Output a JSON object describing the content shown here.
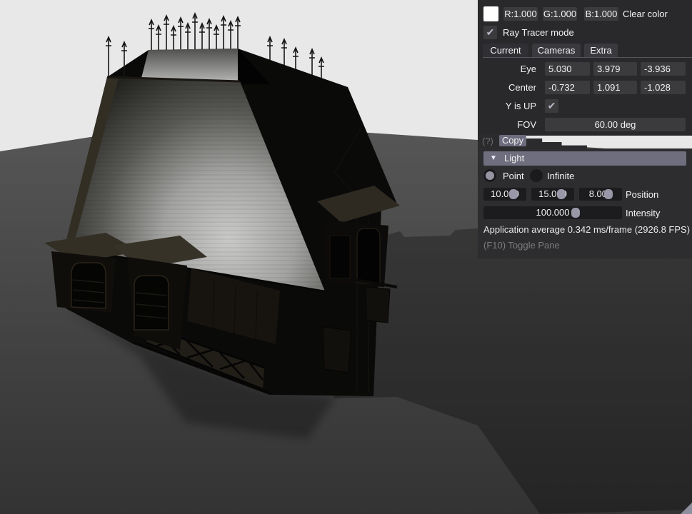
{
  "panel": {
    "clear_color": {
      "swatch_color": "#ffffff",
      "r": "R:1.000",
      "g": "G:1.000",
      "b": "B:1.000",
      "label": "Clear color"
    },
    "ray_tracer": {
      "label": "Ray Tracer mode",
      "checked": true
    },
    "tabs": [
      {
        "label": "Current",
        "active": true
      },
      {
        "label": "Cameras",
        "active": false
      },
      {
        "label": "Extra",
        "active": false
      }
    ],
    "camera": {
      "eye_label": "Eye",
      "eye": [
        "5.030",
        "3.979",
        "-3.936"
      ],
      "center_label": "Center",
      "center": [
        "-0.732",
        "1.091",
        "-1.028"
      ],
      "y_up_label": "Y is UP",
      "y_up_checked": true,
      "fov_label": "FOV",
      "fov": "60.00 deg"
    },
    "help": "(?)",
    "copy": "Copy",
    "light": {
      "header": "Light",
      "point": "Point",
      "infinite": "Infinite",
      "point_selected": true,
      "position": [
        "10.000",
        "15.000",
        "8.000"
      ],
      "position_label": "Position",
      "intensity": "100.000",
      "intensity_label": "Intensity"
    },
    "stats": "Application average 0.342 ms/frame (2926.8 FPS)",
    "hint": "(F10) Toggle Pane"
  },
  "icons": {
    "checkmark": "✔",
    "collapse_triangle": "▼"
  },
  "colors": {
    "accent": "#6e6e7e",
    "panel_bg": "#29292c",
    "frame_bg": "#3b3b3e",
    "slider_bg": "#1c1c1f",
    "grab": "#9898a8",
    "sky": "#e8e8e9",
    "floor_top": "#545454",
    "floor_bottom": "#333333",
    "resize_grip": "#8e8e9e"
  }
}
